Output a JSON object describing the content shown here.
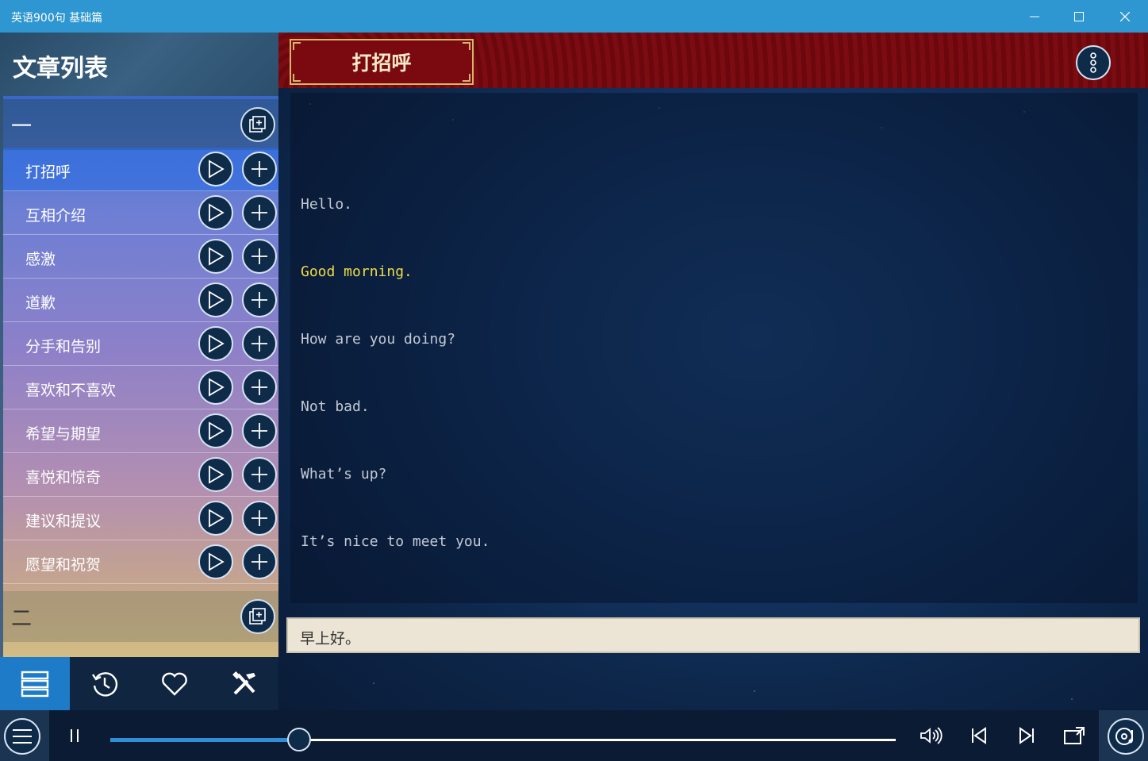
{
  "window": {
    "title": "英语900句 基础篇"
  },
  "sidebar": {
    "title": "文章列表",
    "groups": [
      {
        "label": "一"
      },
      {
        "label": "二"
      }
    ],
    "items": [
      {
        "label": "打招呼",
        "active": true
      },
      {
        "label": "互相介绍"
      },
      {
        "label": "感激"
      },
      {
        "label": "道歉"
      },
      {
        "label": "分手和告别"
      },
      {
        "label": "喜欢和不喜欢"
      },
      {
        "label": "希望与期望"
      },
      {
        "label": "喜悦和惊奇"
      },
      {
        "label": "建议和提议"
      },
      {
        "label": "愿望和祝贺"
      }
    ],
    "bottom_tabs": [
      {
        "icon": "list-icon",
        "active": true
      },
      {
        "icon": "history-icon"
      },
      {
        "icon": "heart-icon"
      },
      {
        "icon": "tools-icon"
      }
    ]
  },
  "main": {
    "lesson_title": "打招呼",
    "lines": [
      {
        "text": "Hello."
      },
      {
        "text": "Good morning.",
        "highlight": true
      },
      {
        "text": "How are you doing?"
      },
      {
        "text": "Not bad."
      },
      {
        "text": "What’s up?"
      },
      {
        "text": "It’s nice to meet you."
      }
    ],
    "translation": "早上好。"
  },
  "player": {
    "progress": 0.24,
    "state": "playing"
  },
  "colors": {
    "titlebar": "#2e96d0",
    "accent": "#2e8fd8",
    "highlight_text": "#f0dc48",
    "banner_red": "#6d0a10"
  }
}
